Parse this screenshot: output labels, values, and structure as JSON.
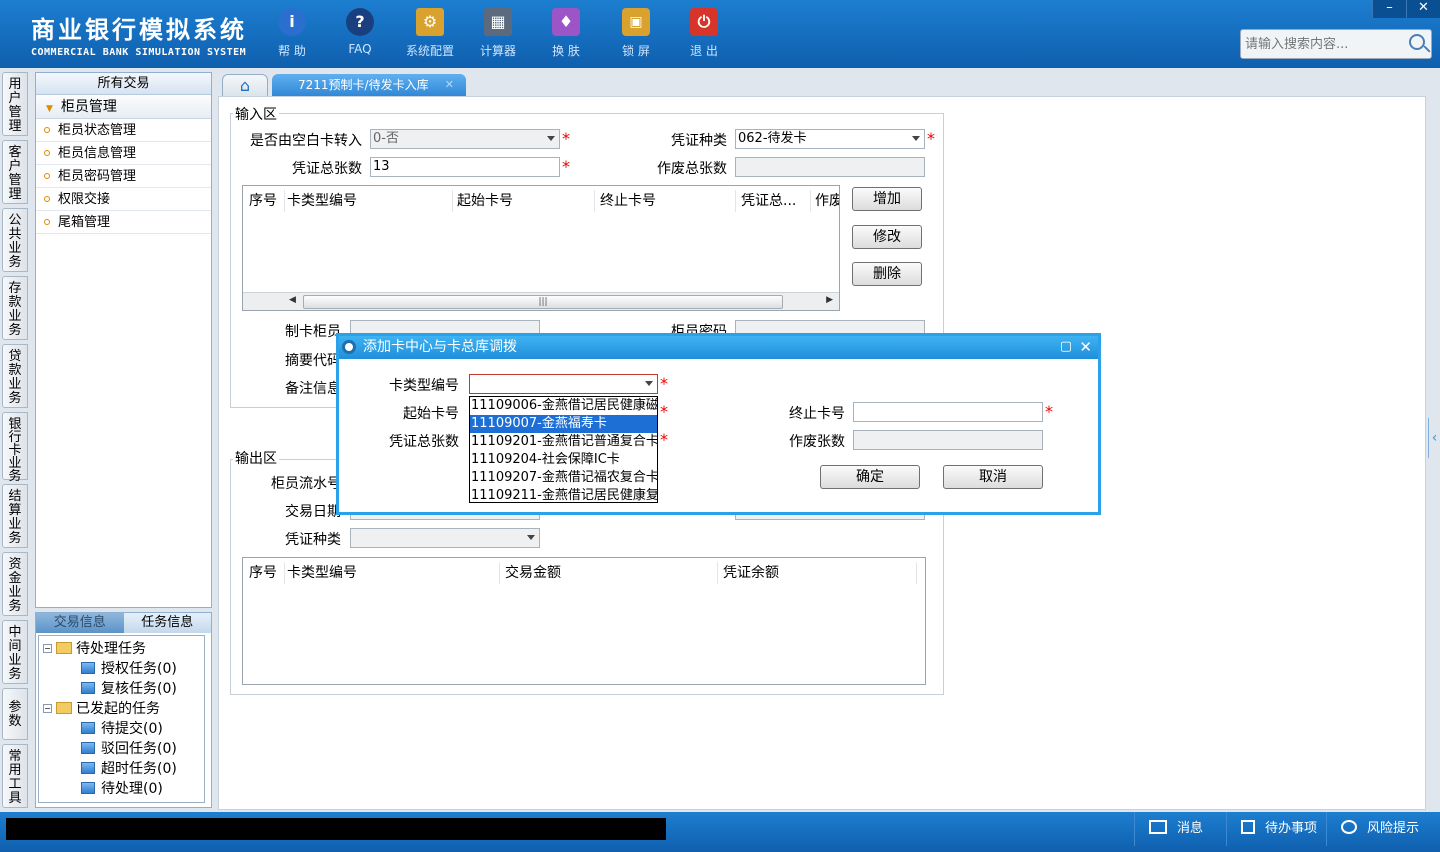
{
  "header": {
    "title_cn": "商业银行模拟系统",
    "title_en": "COMMERCIAL BANK SIMULATION SYSTEM",
    "tools": [
      {
        "label": "帮 助",
        "icon": "info-icon",
        "glyph": "i",
        "color": "#2a6fd0"
      },
      {
        "label": "FAQ",
        "icon": "help-icon",
        "glyph": "?",
        "color": "#1a3f80"
      },
      {
        "label": "系统配置",
        "icon": "toolbox-icon",
        "glyph": "⚙",
        "color": "#d9a12e"
      },
      {
        "label": "计算器",
        "icon": "calculator-icon",
        "glyph": "▦",
        "color": "#5b6b7d"
      },
      {
        "label": "换 肤",
        "icon": "tshirt-icon",
        "glyph": "♦",
        "color": "#9b55c6"
      },
      {
        "label": "锁 屏",
        "icon": "lock-icon",
        "glyph": "🔒",
        "color": "#d9a12e"
      },
      {
        "label": "退 出",
        "icon": "power-icon",
        "glyph": "⏻",
        "color": "#d8352a"
      }
    ],
    "search_placeholder": "请输入搜索内容...",
    "window_minimize": "–",
    "window_close": "✕"
  },
  "vtabs": [
    "用户管理",
    "客户管理",
    "公共业务",
    "存款业务",
    "贷款业务",
    "银行卡业务",
    "结算业务",
    "资金业务",
    "中间业务",
    "参数",
    "常用工具"
  ],
  "left_panel": {
    "header": "所有交易",
    "group": "柜员管理",
    "items": [
      "柜员状态管理",
      "柜员信息管理",
      "柜员密码管理",
      "权限交接",
      "尾箱管理"
    ]
  },
  "task_panel": {
    "tabs": [
      "交易信息",
      "任务信息"
    ],
    "tree": [
      {
        "label": "待处理任务",
        "children": [
          "授权任务(0)",
          "复核任务(0)"
        ]
      },
      {
        "label": "已发起的任务",
        "children": [
          "待提交(0)",
          "驳回任务(0)",
          "超时任务(0)",
          "待处理(0)"
        ]
      }
    ]
  },
  "tabs": {
    "active": "7211预制卡/待发卡入库"
  },
  "input_area": {
    "legend": "输入区",
    "blank_card_label": "是否由空白卡转入",
    "blank_card_value": "0-否",
    "voucher_type_label": "凭证种类",
    "voucher_type_value": "062-待发卡",
    "voucher_total_label": "凭证总张数",
    "voucher_total_value": "13",
    "void_total_label": "作废总张数",
    "void_total_value": "",
    "grid_headers": [
      "序号",
      "卡类型编号",
      "起始卡号",
      "终止卡号",
      "凭证总...",
      "作废"
    ],
    "buttons": {
      "add": "增加",
      "modify": "修改",
      "delete": "删除"
    },
    "maker_label": "制卡柜员",
    "teller_pwd_label": "柜员密码",
    "summary_label": "摘要代码",
    "remark_label": "备注信息"
  },
  "output_area": {
    "legend": "输出区",
    "serial_label": "柜员流水号",
    "date_label": "交易日期",
    "voucher_type_label": "凭证种类",
    "grid_headers": [
      "序号",
      "卡类型编号",
      "交易金额",
      "凭证余额"
    ]
  },
  "dialog": {
    "title": "添加卡中心与卡总库调拨",
    "card_type_label": "卡类型编号",
    "start_no_label": "起始卡号",
    "end_no_label": "终止卡号",
    "voucher_total_label": "凭证总张数",
    "void_count_label": "作废张数",
    "confirm": "确定",
    "cancel": "取消",
    "dropdown_options": [
      "11109006-金燕借记居民健康磁",
      "11109007-金燕福寿卡",
      "11109201-金燕借记普通复合卡",
      "11109204-社会保障IC卡",
      "11109207-金燕借记福农复合卡",
      "11109211-金燕借记居民健康复"
    ],
    "selected_index": 1
  },
  "statusbar": {
    "messages": "消息",
    "todo": "待办事项",
    "risk": "风险提示"
  },
  "required_mark": "*",
  "colors": {
    "header_blue": "#1a78cc",
    "dialog_border": "#2aa1e8",
    "selection": "#1d6fd6",
    "required": "#e00000"
  }
}
